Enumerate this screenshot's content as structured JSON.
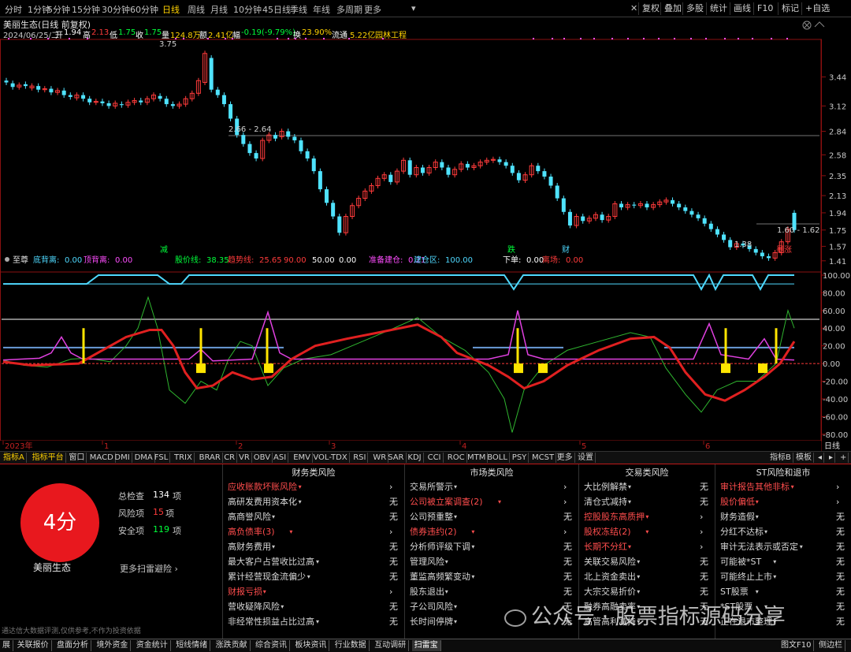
{
  "toolbar": {
    "periods": [
      "分时",
      "1分钟",
      "5分钟",
      "15分钟",
      "30分钟",
      "60分钟",
      "日线",
      "周线",
      "月线",
      "10分钟",
      "45日线",
      "季线",
      "年线",
      "多周期",
      "更多"
    ],
    "active": "日线",
    "right_buttons": [
      "复权",
      "叠加",
      "多股",
      "统计",
      "画线",
      "F10",
      "标记",
      "+自选"
    ]
  },
  "info": {
    "title": "美丽生态(日线 前复权)",
    "date": "2024/06/25/二",
    "open_label": "开",
    "open": "1.94",
    "high_label": "高",
    "high": "2.13",
    "low_label": "低",
    "low": "1.75",
    "close_label": "收",
    "close": "1.75",
    "volume_label": "量",
    "volume": "124.8万",
    "amount_label": "额",
    "amount": "2.41亿",
    "change_label": "幅",
    "change": "-0.19(-9.79%)",
    "turnover_label": "换",
    "turnover": "23.90%",
    "float_label": "流通",
    "float": "5.22亿",
    "industry": "园林工程"
  },
  "main_chart": {
    "y_ticks": [
      "3.44",
      "3.12",
      "2.84",
      "2.58",
      "2.35",
      "2.13",
      "1.94",
      "1.75",
      "1.57",
      "1.41"
    ],
    "annotations": {
      "high": "3.75",
      "mid": "2.66 - 2.64",
      "low": "1.38",
      "range": "1.60 - 1.62"
    },
    "markers": [
      "减",
      "跌",
      "财",
      "暴涨"
    ]
  },
  "indicator": {
    "name": "至尊",
    "legend": [
      {
        "label": "底背离:",
        "value": "0.00",
        "color": "#4fd9ff"
      },
      {
        "label": "顶背离:",
        "value": "0.00",
        "color": "#ff4dff"
      },
      {
        "label": "股价线:",
        "value": "38.35",
        "color": "#00ff3a"
      },
      {
        "label": "趋势线:",
        "value": "25.65",
        "color": "#ff3b3b"
      },
      {
        "label": "",
        "value": "90.00",
        "color": "#ff3b3b"
      },
      {
        "label": "",
        "value": "50.00",
        "color": "#ffffff"
      },
      {
        "label": "",
        "value": "0.00",
        "color": "#ffffff"
      },
      {
        "label": "准备建仓:",
        "value": "0.21",
        "color": "#ff4dff"
      },
      {
        "label": "建仓区:",
        "value": "100.00",
        "color": "#4fd9ff"
      },
      {
        "label": "下单:",
        "value": "0.00",
        "color": "#ffffff"
      },
      {
        "label": "离场:",
        "value": "0.00",
        "color": "#ff3b3b"
      }
    ],
    "y_ticks": [
      "100.00",
      "80.00",
      "60.00",
      "40.00",
      "20.00",
      "0.00",
      "-20.00",
      "-40.00",
      "-60.00",
      "-80.00"
    ]
  },
  "time_axis": {
    "labels": [
      "2023年",
      "1",
      "2",
      "3",
      "4",
      "5",
      "6"
    ],
    "right": "日线"
  },
  "tabs": [
    "指标A",
    "指标平台",
    "窗口",
    "MACD",
    "DMI",
    "DMA",
    "FSL",
    "TRIX",
    "BRAR",
    "CR",
    "VR",
    "OBV",
    "ASI",
    "EMV",
    "VOL-TDX",
    "RSI",
    "WR",
    "SAR",
    "KDJ",
    "CCI",
    "ROC",
    "MTM",
    "BOLL",
    "PSY",
    "MCST",
    "更多",
    "设置"
  ],
  "tabs_right": [
    "指标B",
    "模板"
  ],
  "scan": {
    "score": "4分",
    "stock": "美丽生态",
    "total_label": "总检查",
    "total": "134",
    "total_unit": "项",
    "risk_label": "风险项",
    "risk": "15",
    "risk_unit": "项",
    "safe_label": "安全项",
    "safe": "119",
    "safe_unit": "项",
    "more": "更多扫雷避险 ›"
  },
  "columns": [
    {
      "title": "财务类风险",
      "items": [
        {
          "t": "应收账款坏账风险",
          "r": true,
          "v": "›"
        },
        {
          "t": "高研发费用资本化",
          "r": false,
          "v": "无"
        },
        {
          "t": "高商誉风险",
          "r": false,
          "v": "无"
        },
        {
          "t": "高负债率(3)",
          "r": true,
          "v": "›"
        },
        {
          "t": "高财务费用",
          "r": false,
          "v": "无"
        },
        {
          "t": "最大客户占营收比过高",
          "r": false,
          "v": "无"
        },
        {
          "t": "累计经营现金流偏少",
          "r": false,
          "v": "无"
        },
        {
          "t": "财报亏损",
          "r": true,
          "v": "›"
        },
        {
          "t": "营收疑降风险",
          "r": false,
          "v": "无"
        },
        {
          "t": "非经常性损益占比过高",
          "r": false,
          "v": "无"
        }
      ]
    },
    {
      "title": "市场类风险",
      "items": [
        {
          "t": "交易所警示",
          "r": false,
          "v": "›"
        },
        {
          "t": "公司被立案调查(2)",
          "r": true,
          "v": "›"
        },
        {
          "t": "公司预重整",
          "r": false,
          "v": "无"
        },
        {
          "t": "债券违约(2)",
          "r": true,
          "v": "›"
        },
        {
          "t": "分析师评级下调",
          "r": false,
          "v": "无"
        },
        {
          "t": "管理风险",
          "r": false,
          "v": "无"
        },
        {
          "t": "董监高频繁变动",
          "r": false,
          "v": "无"
        },
        {
          "t": "股东退出",
          "r": false,
          "v": "无"
        },
        {
          "t": "子公司风险",
          "r": false,
          "v": "无"
        },
        {
          "t": "长时间停牌",
          "r": false,
          "v": "无"
        }
      ]
    },
    {
      "title": "交易类风险",
      "items": [
        {
          "t": "大比例解禁",
          "r": false,
          "v": "无"
        },
        {
          "t": "清仓式减持",
          "r": false,
          "v": "无"
        },
        {
          "t": "控股股东高质押",
          "r": true,
          "v": "›"
        },
        {
          "t": "股权冻结(2)",
          "r": true,
          "v": "›"
        },
        {
          "t": "长期不分红",
          "r": true,
          "v": "›"
        },
        {
          "t": "关联交易风险",
          "r": false,
          "v": "无"
        },
        {
          "t": "北上资金卖出",
          "r": false,
          "v": "无"
        },
        {
          "t": "大宗交易折价",
          "r": false,
          "v": "无"
        },
        {
          "t": "融券高融卖率",
          "r": false,
          "v": "无"
        },
        {
          "t": "高管高利减持",
          "r": false,
          "v": "无"
        }
      ]
    },
    {
      "title": "ST风险和退市",
      "items": [
        {
          "t": "审计报告其他非标",
          "r": true,
          "v": "›"
        },
        {
          "t": "股价偏低",
          "r": true,
          "v": "›"
        },
        {
          "t": "财务造假",
          "r": false,
          "v": "无"
        },
        {
          "t": "分红不达标",
          "r": false,
          "v": "无"
        },
        {
          "t": "审计无法表示或否定",
          "r": false,
          "v": "无"
        },
        {
          "t": "可能被*ST",
          "r": false,
          "v": "无"
        },
        {
          "t": "可能终止上市",
          "r": false,
          "v": "无"
        },
        {
          "t": "ST股票",
          "r": false,
          "v": "无"
        },
        {
          "t": "*ST股票",
          "r": false,
          "v": "无"
        },
        {
          "t": "正在退市整理",
          "r": false,
          "v": "无"
        }
      ]
    }
  ],
  "disclaimer": "通达信大数据评测,仅供参考,不作为投资依据",
  "statusbar": [
    "展",
    "关联报价",
    "盘面分析",
    "境外资金",
    "资金统计",
    "短线情绪",
    "涨跌贡献",
    "综合资讯",
    "板块资讯",
    "行业数据",
    "互动调研",
    "扫雷宝"
  ],
  "statusbar_right": "图文F10",
  "statusbar_far": "侧边栏",
  "watermark": "公众号 · 股票指标源码分享"
}
